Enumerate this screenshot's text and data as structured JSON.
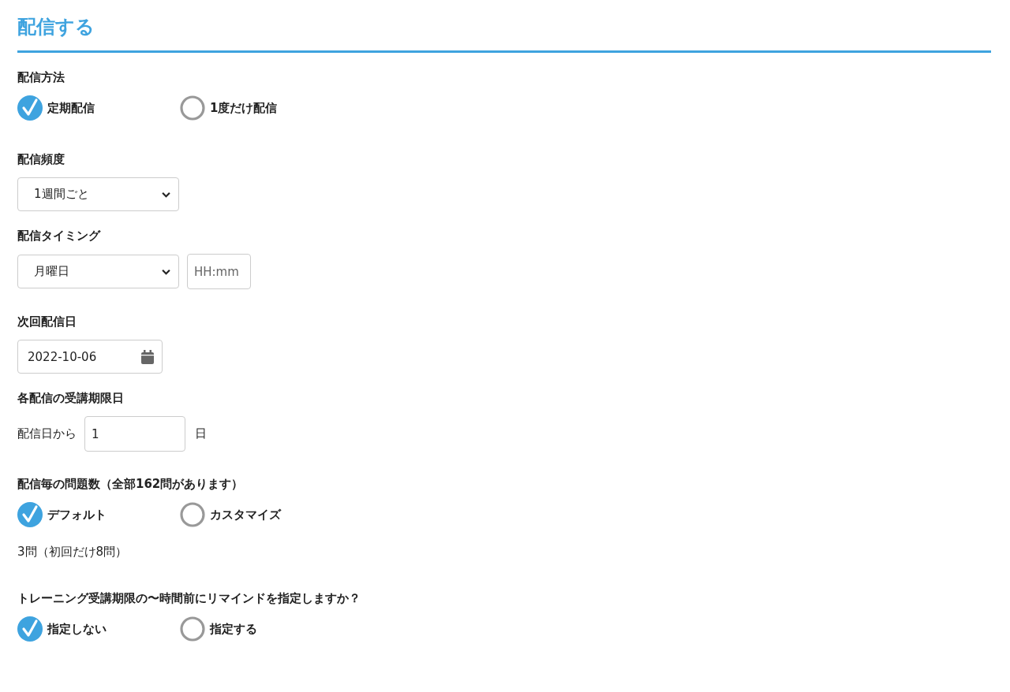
{
  "title": "配信する",
  "sections": [
    {
      "kind": "radios",
      "label": "配信方法",
      "options": [
        {
          "label": "定期配信",
          "selected": true
        },
        {
          "label": "1度だけ配信",
          "selected": false
        }
      ]
    },
    {
      "kind": "select",
      "label": "配信頻度",
      "value": "1週間ごと"
    },
    {
      "kind": "timing",
      "label": "配信タイミング",
      "value": "月曜日",
      "placeholder": "HH:mm"
    },
    {
      "kind": "date",
      "label": "次回配信日",
      "value": "2022-10-06"
    },
    {
      "kind": "days",
      "label": "各配信の受講期限日",
      "prefix": "配信日から",
      "value": "1",
      "suffix": "日"
    },
    {
      "kind": "radios",
      "label": "配信毎の問題数（全部162問があります）",
      "options": [
        {
          "label": "デフォルト",
          "selected": true
        },
        {
          "label": "カスタマイズ",
          "selected": false
        }
      ],
      "note": "3問（初回だけ8問）"
    },
    {
      "kind": "radios",
      "label": "トレーニング受講期限の〜時間前にリマインドを指定しますか？",
      "options": [
        {
          "label": "指定しない",
          "selected": true
        },
        {
          "label": "指定する",
          "selected": false
        }
      ]
    }
  ]
}
